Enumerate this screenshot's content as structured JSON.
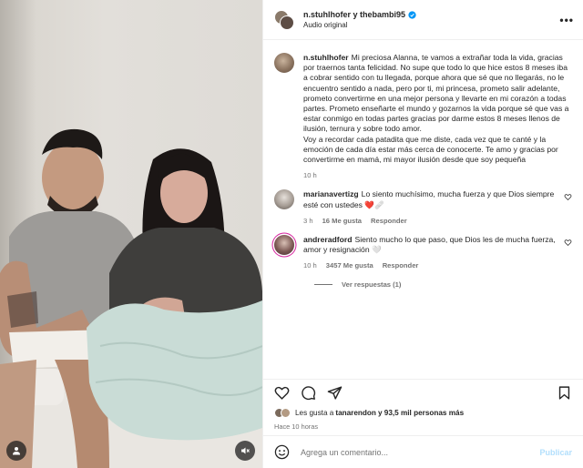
{
  "header": {
    "users": "n.stuhlhofer y thebambi95",
    "audio": "Audio original",
    "more_icon": "more-horizontal-icon"
  },
  "caption": {
    "username": "n.stuhlhofer",
    "text": "Mi preciosa Alanna, te vamos a extrañar toda la vida, gracias por traernos tanta felicidad. No supe que todo lo que hice estos 8 meses iba a cobrar sentido con tu llegada, porque ahora que sé que no llegarás, no le encuentro sentido a nada, pero por ti, mi princesa, prometo salir adelante, prometo convertirme en una mejor persona y llevarte en mi corazón a todas partes. Prometo enseñarte el mundo y gozarnos la vida porque sé que vas a estar conmigo en todas partes gracias por darme estos 8 meses llenos de ilusión, ternura y sobre todo amor.\nVoy a recordar cada patadita que me diste, cada vez que te canté y la emoción de cada día estar más cerca de conocerte. Te amo y gracias por convertirme en mamá, mi mayor ilusión desde que soy pequeña",
    "time": "10 h"
  },
  "comments": [
    {
      "username": "marianavertizg",
      "text": "Lo siento muchísimo, mucha fuerza y que Dios siempre esté con ustedes ❤️🩹",
      "time": "3 h",
      "likes": "16 Me gusta",
      "reply": "Responder"
    },
    {
      "username": "andreradford",
      "text": "Siento mucho lo que paso, que Dios les de mucha fuerza, amor y resignación 🤍",
      "time": "10 h",
      "likes": "3457 Me gusta",
      "reply": "Responder",
      "view_replies": "Ver respuestas (1)"
    }
  ],
  "likes_line": {
    "prefix": "Les gusta a ",
    "user": "tanarendon",
    "suffix": " y 93,5 mil personas más"
  },
  "post_time": "Hace 10 horas",
  "add_comment": {
    "placeholder": "Agrega un comentario...",
    "publish": "Publicar"
  },
  "colors": {
    "verified": "#0095f6",
    "publish_disabled": "#b2dffc",
    "story_ring": "#d6249f"
  },
  "icons": [
    "heart-icon",
    "comment-icon",
    "share-icon",
    "save-icon",
    "emoji-icon",
    "user-tag-icon",
    "mute-icon"
  ]
}
